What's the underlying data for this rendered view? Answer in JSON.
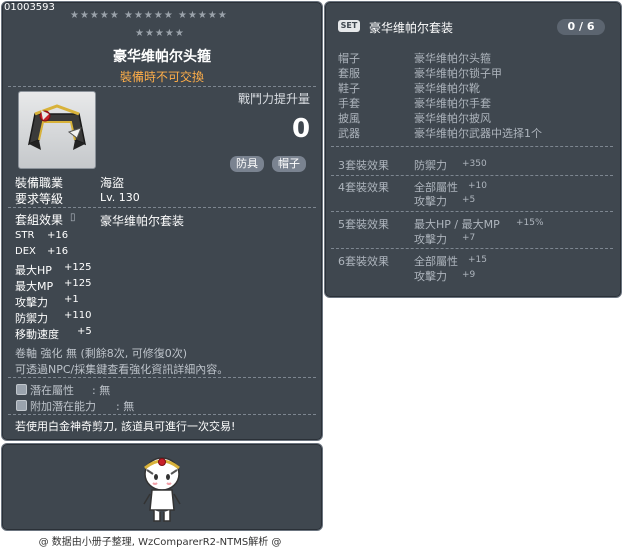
{
  "item": {
    "code": "01003593",
    "name": "豪华维帕尔头箍",
    "trade_note": "裝備時不可交換",
    "damage_label": "戰鬥力提升量",
    "damage_value": "0",
    "tags": [
      "防具",
      "帽子"
    ],
    "job_label": "裝備職業",
    "job_value": "海盜",
    "level_label": "要求等級",
    "level_value": "Lv. 130",
    "set_label": "套組效果",
    "set_name": "豪华维帕尔套装",
    "stats": [
      {
        "name": "STR",
        "value": "+16"
      },
      {
        "name": "DEX",
        "value": "+16"
      },
      {
        "name": "最大HP",
        "value": "+125"
      },
      {
        "name": "最大MP",
        "value": "+125"
      },
      {
        "name": "攻擊力",
        "value": "+1"
      },
      {
        "name": "防禦力",
        "value": "+110"
      },
      {
        "name": "移動速度",
        "value": "+5"
      }
    ],
    "scroll_line": "卷軸 強化 無 (剩餘8次, 可修復0次)",
    "enhance_line": "可透過NPC/採集鍵查看強化資訊詳細內容。",
    "potential_label": "潛在屬性",
    "potential_value": ": 無",
    "bonus_potential_label": "附加潛在能力",
    "bonus_potential_value": ": 無",
    "scissors_note": "若使用白金神奇剪刀, 該道具可進行一次交易!"
  },
  "set": {
    "badge": "SET",
    "name": "豪华维帕尔套装",
    "count": "0 / 6",
    "parts": [
      {
        "slot": "帽子",
        "item": "豪华维帕尔头箍"
      },
      {
        "slot": "套服",
        "item": "豪华维帕尔锁子甲"
      },
      {
        "slot": "鞋子",
        "item": "豪华维帕尔靴"
      },
      {
        "slot": "手套",
        "item": "豪华维帕尔手套"
      },
      {
        "slot": "披風",
        "item": "豪华维帕尔披风"
      },
      {
        "slot": "武器",
        "item": "豪华维帕尔武器中选择1个"
      }
    ],
    "effects": [
      {
        "tier": "3套裝效果",
        "lines": [
          {
            "stat": "防禦力",
            "value": "+350"
          }
        ]
      },
      {
        "tier": "4套裝效果",
        "lines": [
          {
            "stat": "全部屬性",
            "value": "+10"
          },
          {
            "stat": "攻擊力",
            "value": "+5"
          }
        ]
      },
      {
        "tier": "5套裝效果",
        "lines": [
          {
            "stat": "最大HP / 最大MP",
            "value": "+15%"
          },
          {
            "stat": "攻擊力",
            "value": "+7"
          }
        ]
      },
      {
        "tier": "6套裝效果",
        "lines": [
          {
            "stat": "全部屬性",
            "value": "+15"
          },
          {
            "stat": "攻擊力",
            "value": "+9"
          }
        ]
      }
    ]
  },
  "footer": "@ 数据由小册子整理, WzComparerR2-NTMS解析 @"
}
